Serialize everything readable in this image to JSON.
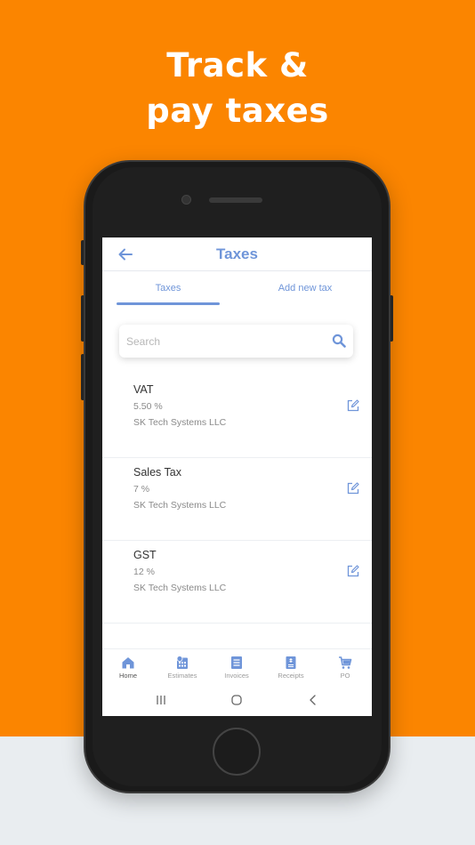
{
  "promo": {
    "line1": "Track &",
    "line2": "pay taxes"
  },
  "appbar": {
    "title": "Taxes",
    "back_icon": "arrow-left-icon"
  },
  "tabs": [
    {
      "label": "Taxes",
      "active": true
    },
    {
      "label": "Add new tax",
      "active": false
    }
  ],
  "search": {
    "placeholder": "Search",
    "value": ""
  },
  "taxes": [
    {
      "name": "VAT",
      "rate": "5.50 %",
      "company": "SK Tech Systems LLC"
    },
    {
      "name": "Sales Tax",
      "rate": "7 %",
      "company": "SK Tech Systems LLC"
    },
    {
      "name": "GST",
      "rate": "12 %",
      "company": "SK Tech Systems LLC"
    }
  ],
  "bottom_nav": [
    {
      "label": "Home",
      "icon": "home-icon",
      "active": true
    },
    {
      "label": "Estimates",
      "icon": "estimate-icon",
      "active": false
    },
    {
      "label": "Invoices",
      "icon": "invoice-icon",
      "active": false
    },
    {
      "label": "Receipts",
      "icon": "receipt-icon",
      "active": false
    },
    {
      "label": "PO",
      "icon": "cart-icon",
      "active": false
    }
  ],
  "colors": {
    "accent": "#6f95d9",
    "background": "#fb8500",
    "base": "#e9edf0"
  }
}
